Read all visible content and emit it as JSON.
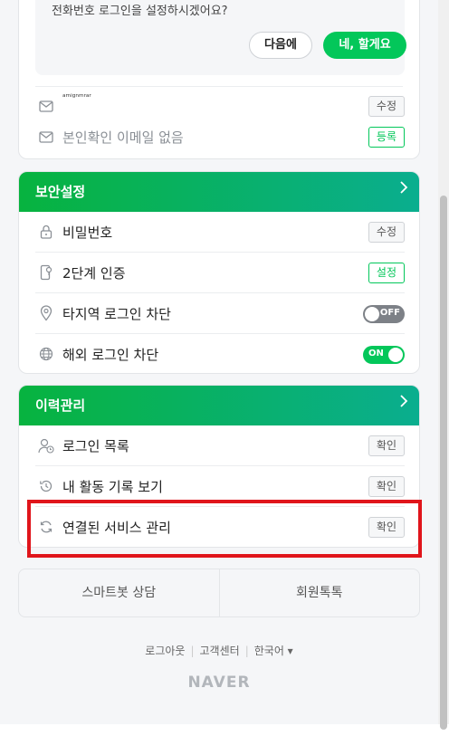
{
  "phone_prompt": {
    "message": "전화번호 로그인을 설정하시겠어요?",
    "later_label": "다음에",
    "yes_label": "네, 할게요"
  },
  "email_rows": [
    {
      "icon": "mail-icon",
      "label": "ᵃᵐⁱᵍⁿᵐʳᵃʳ",
      "action": "수정",
      "action_style": "gray"
    },
    {
      "icon": "mail-icon",
      "label": "본인확인 이메일 없음",
      "action": "등록",
      "action_style": "green"
    }
  ],
  "security": {
    "title": "보안설정",
    "items": [
      {
        "icon": "lock-icon",
        "label": "비밀번호",
        "action": "수정",
        "action_style": "gray"
      },
      {
        "icon": "phone-key-icon",
        "label": "2단계 인증",
        "action": "설정",
        "action_style": "green"
      },
      {
        "icon": "location-pin-icon",
        "label": "타지역 로그인 차단",
        "toggle": "OFF"
      },
      {
        "icon": "globe-icon",
        "label": "해외 로그인 차단",
        "toggle": "ON"
      }
    ]
  },
  "history": {
    "title": "이력관리",
    "items": [
      {
        "icon": "user-clock-icon",
        "label": "로그인 목록",
        "action": "확인"
      },
      {
        "icon": "history-icon",
        "label": "내 활동 기록 보기",
        "action": "확인"
      },
      {
        "icon": "refresh-icon",
        "label": "연결된 서비스 관리",
        "action": "확인"
      }
    ]
  },
  "footer_buttons": {
    "smartbot": "스마트봇 상담",
    "talktalk": "회원톡톡"
  },
  "footer_links": {
    "logout": "로그아웃",
    "customer_center": "고객센터",
    "language": "한국어 ▾"
  },
  "brand": "NAVER",
  "colors": {
    "brand_green": "#03c75a",
    "highlight_red": "#e0151b"
  }
}
